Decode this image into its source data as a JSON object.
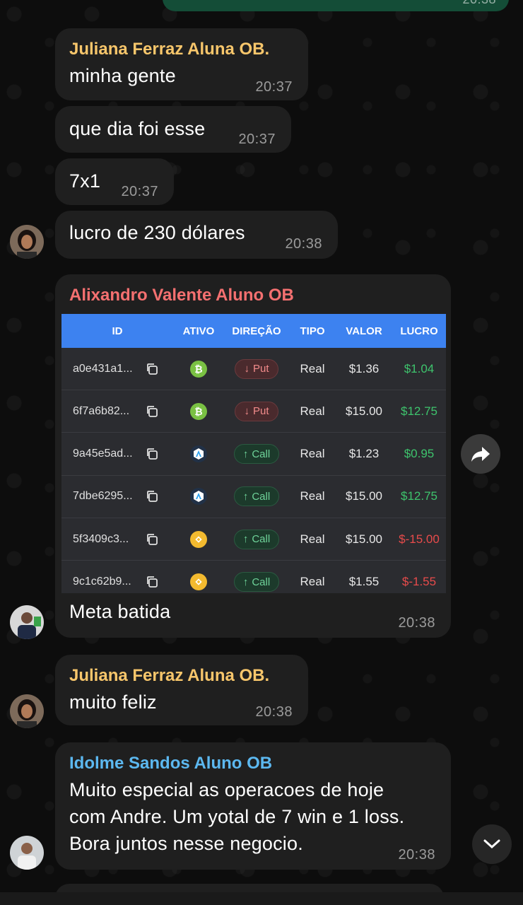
{
  "colors": {
    "sender_juliana": "#f7c66b",
    "sender_alixandro": "#f47070",
    "sender_idolme": "#5cb8f0",
    "bubble_incoming": "#1f1f1f",
    "bubble_outgoing": "#144d37",
    "table_header": "#3d82f0",
    "profit_positive": "#3ec46d",
    "profit_negative": "#e84b4b"
  },
  "messages": {
    "top_outgoing_time": "20:38",
    "m1": {
      "sender": "Juliana Ferraz Aluna OB.",
      "text": "minha gente",
      "time": "20:37"
    },
    "m2": {
      "text": "que dia foi esse",
      "time": "20:37"
    },
    "m3": {
      "text": "7x1",
      "time": "20:37"
    },
    "m4": {
      "text": "lucro de 230 dólares",
      "time": "20:38"
    },
    "m5": {
      "sender": "Alixandro Valente Aluno OB",
      "caption": "Meta batida",
      "time": "20:38",
      "table": {
        "headers": [
          "ID",
          "ATIVO",
          "DIREÇÃO",
          "TIPO",
          "VALOR",
          "LUCRO"
        ],
        "rows": [
          {
            "id": "a0e431a1...",
            "asset_icon": "bitcoin-icon",
            "direction": "Put",
            "type": "Real",
            "value": "$1.36",
            "profit": "$1.04",
            "sign": "pos"
          },
          {
            "id": "6f7a6b82...",
            "asset_icon": "bitcoin-icon",
            "direction": "Put",
            "type": "Real",
            "value": "$15.00",
            "profit": "$12.75",
            "sign": "pos"
          },
          {
            "id": "9a45e5ad...",
            "asset_icon": "arbitrum-icon",
            "direction": "Call",
            "type": "Real",
            "value": "$1.23",
            "profit": "$0.95",
            "sign": "pos"
          },
          {
            "id": "7dbe6295...",
            "asset_icon": "arbitrum-icon",
            "direction": "Call",
            "type": "Real",
            "value": "$15.00",
            "profit": "$12.75",
            "sign": "pos"
          },
          {
            "id": "5f3409c3...",
            "asset_icon": "binance-icon",
            "direction": "Call",
            "type": "Real",
            "value": "$15.00",
            "profit": "$-15.00",
            "sign": "neg"
          },
          {
            "id": "9c1c62b9...",
            "asset_icon": "binance-icon",
            "direction": "Call",
            "type": "Real",
            "value": "$1.55",
            "profit": "$-1.55",
            "sign": "neg"
          }
        ]
      }
    },
    "m6": {
      "sender": "Juliana Ferraz Aluna OB.",
      "text": "muito feliz",
      "time": "20:38"
    },
    "m7": {
      "sender": "Idolme Sandos Aluno OB",
      "lines": [
        "Muito especial as operacoes de hoje",
        "com Andre. Um yotal de 7 win e 1 loss.",
        "Bora juntos nesse negocio."
      ],
      "time": "20:38"
    }
  }
}
